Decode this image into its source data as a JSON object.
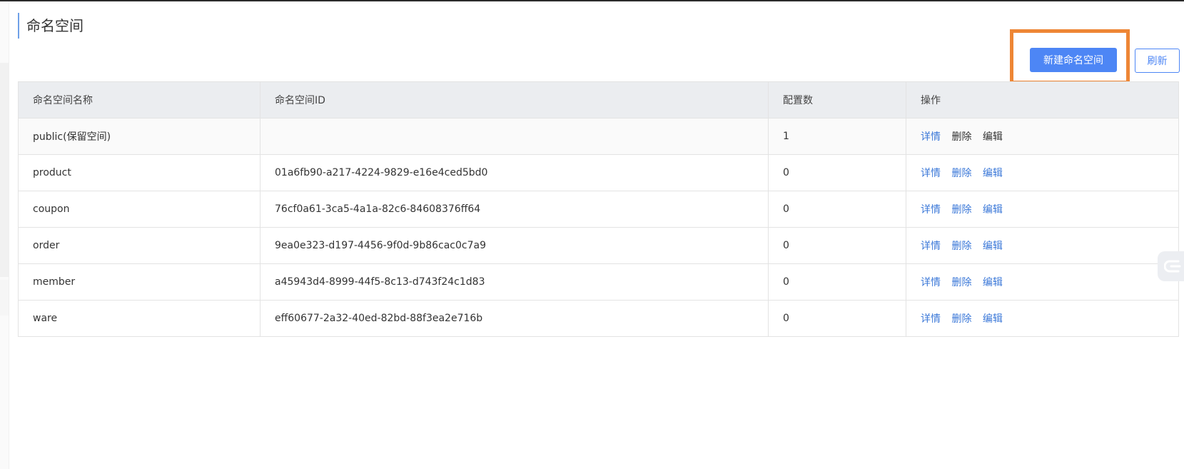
{
  "page": {
    "title": "命名空间"
  },
  "toolbar": {
    "create_label": "新建命名空间",
    "refresh_label": "刷新"
  },
  "table": {
    "columns": [
      "命名空间名称",
      "命名空间ID",
      "配置数",
      "操作"
    ],
    "rows": [
      {
        "name": "public(保留空间)",
        "id": "",
        "count": "1"
      },
      {
        "name": "product",
        "id": "01a6fb90-a217-4224-9829-e16e4ced5bd0",
        "count": "0"
      },
      {
        "name": "coupon",
        "id": "76cf0a61-3ca5-4a1a-82c6-84608376ff64",
        "count": "0"
      },
      {
        "name": "order",
        "id": "9ea0e323-d197-4456-9f0d-9b86cac0c7a9",
        "count": "0"
      },
      {
        "name": "member",
        "id": "a45943d4-8999-44f5-8c13-d743f24c1d83",
        "count": "0"
      },
      {
        "name": "ware",
        "id": "eff60677-2a32-40ed-82bd-88f3ea2e716b",
        "count": "0"
      }
    ],
    "actions": {
      "detail": "详情",
      "delete": "删除",
      "edit": "编辑"
    }
  },
  "colors": {
    "primary": "#4d86f5",
    "highlight": "#ee8635",
    "link": "#3b78d8",
    "header_bg": "#ebedf0"
  },
  "icons": {
    "side_float": "chat-widget-icon"
  }
}
